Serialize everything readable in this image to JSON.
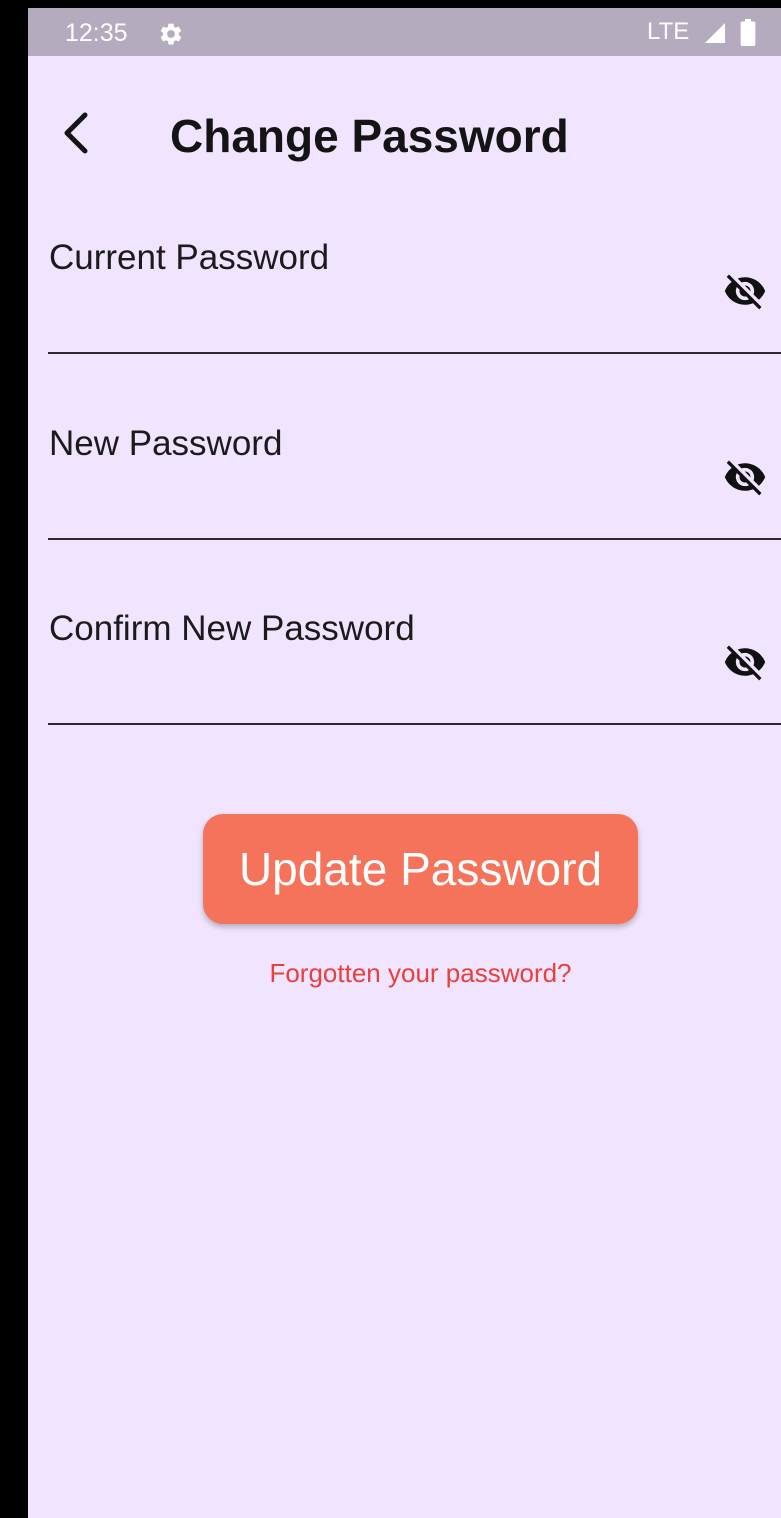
{
  "status_bar": {
    "time": "12:35",
    "network": "LTE",
    "settings_icon": "gear-icon",
    "signal_icon": "signal-icon",
    "battery_icon": "battery-icon"
  },
  "header": {
    "title": "Change Password",
    "back_icon": "chevron-left-icon"
  },
  "form": {
    "fields": [
      {
        "label": "Current Password",
        "value": "",
        "icon": "eye-off-icon"
      },
      {
        "label": "New Password",
        "value": "",
        "icon": "eye-off-icon"
      },
      {
        "label": "Confirm New Password",
        "value": "",
        "icon": "eye-off-icon"
      }
    ],
    "submit_label": "Update Password",
    "forgot_label": "Forgotten your password?"
  },
  "colors": {
    "background": "#f0e4fe",
    "status_bar": "#b4abbe",
    "accent_button": "#f5735a",
    "link": "#e8403a"
  }
}
